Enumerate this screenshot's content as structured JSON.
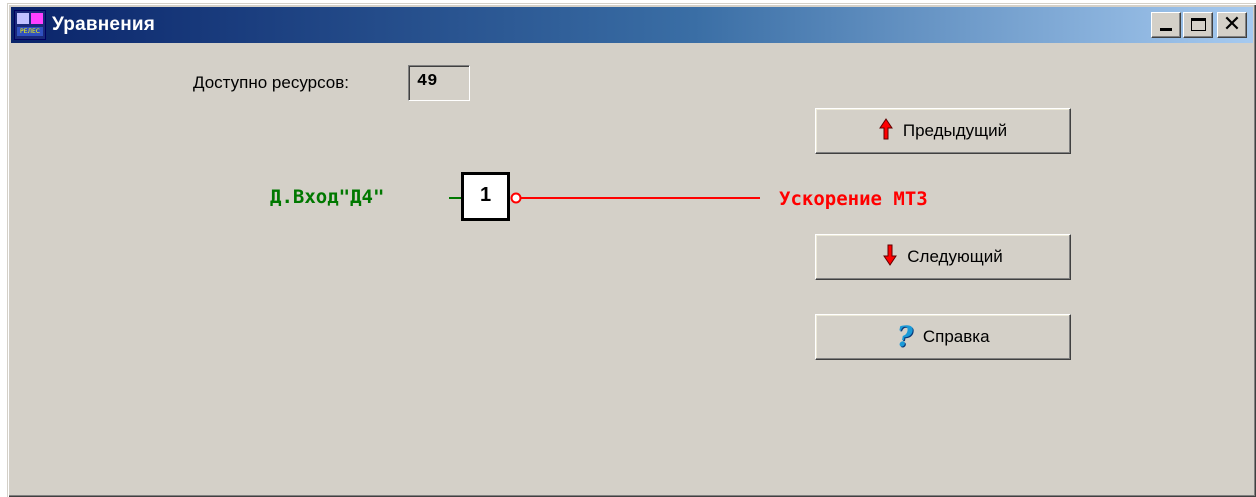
{
  "window": {
    "title": "Уравнения",
    "icon": "app-logo-icon",
    "icon_caption": "РЕЛЕС"
  },
  "caption_buttons": {
    "minimize_icon": "minimize-icon",
    "maximize_icon": "maximize-icon",
    "close_icon": "close-icon",
    "close_glyph": "✕"
  },
  "resources": {
    "label": "Доступно ресурсов:",
    "value": "49"
  },
  "diagram": {
    "input_label": "Д.Вход\"Д4\"",
    "gate_label": "1",
    "output_label": "Ускорение МТЗ",
    "colors": {
      "input": "#007800",
      "output": "#ff0000",
      "gate_border": "#000000"
    }
  },
  "buttons": {
    "prev": {
      "label": "Предыдущий",
      "icon": "arrow-up-icon"
    },
    "next": {
      "label": "Следующий",
      "icon": "arrow-down-icon"
    },
    "help": {
      "label": "Справка",
      "icon": "question-icon",
      "glyph": "?"
    }
  },
  "colors": {
    "window_bg": "#d4d0c8",
    "title_gradient_start": "#0a246a",
    "title_gradient_end": "#a6caf0",
    "arrow_red": "#ff0000"
  }
}
